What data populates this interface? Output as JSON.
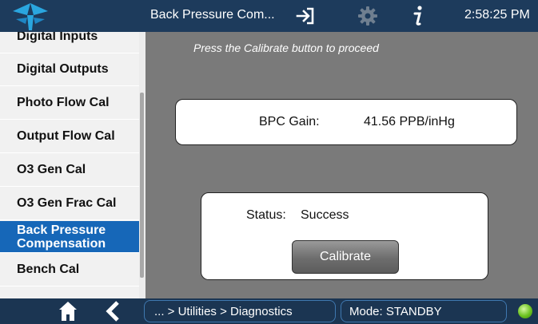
{
  "header": {
    "title": "Back Pressure Com...",
    "clock": "2:58:25 PM",
    "icons": [
      "logo-icon",
      "exit-icon",
      "gear-icon",
      "info-icon"
    ]
  },
  "sidebar": {
    "items": [
      {
        "label": "Digital Inputs"
      },
      {
        "label": "Digital Outputs"
      },
      {
        "label": "Photo Flow Cal"
      },
      {
        "label": "Output Flow Cal"
      },
      {
        "label": "O3 Gen Cal"
      },
      {
        "label": "O3 Gen Frac Cal"
      },
      {
        "label": "Back Pressure Compensation",
        "active": true
      },
      {
        "label": "Bench Cal"
      }
    ]
  },
  "main": {
    "instruction": "Press the Calibrate button to proceed",
    "gain_label": "BPC Gain:",
    "gain_value": "41.56 PPB/inHg",
    "status_label": "Status:",
    "status_value": "Success",
    "calibrate_label": "Calibrate"
  },
  "footer": {
    "breadcrumb": "... > Utilities > Diagnostics",
    "mode": "Mode: STANDBY",
    "icons": [
      "home-icon",
      "back-icon",
      "status-led-icon"
    ]
  },
  "colors": {
    "header_bg": "#1d3b5c",
    "active_item": "#1667b8",
    "main_bg": "#7a7a7a",
    "status_led": "#6cc21f"
  }
}
